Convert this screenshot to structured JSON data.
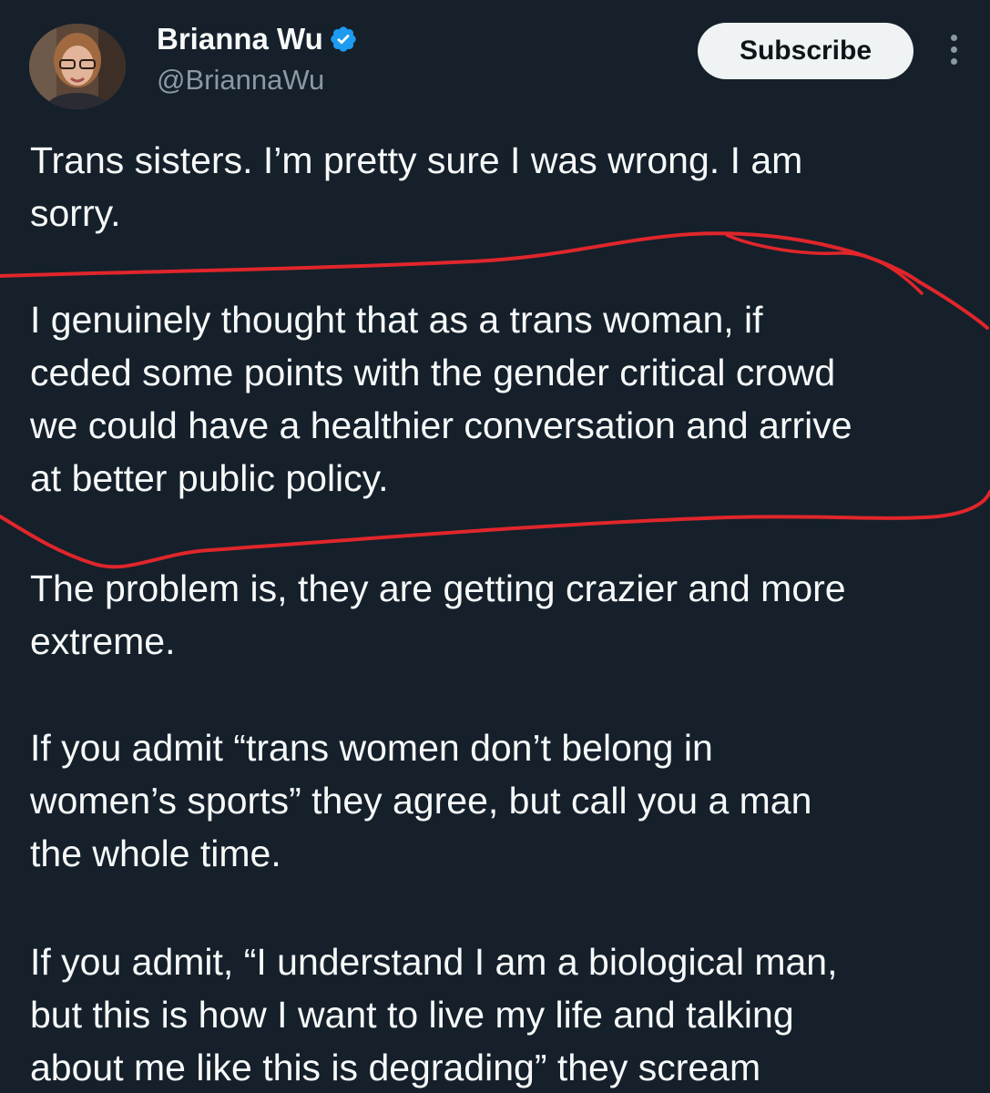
{
  "author": {
    "display_name": "Brianna Wu",
    "handle": "@BriannaWu",
    "verified_icon": "verified-badge-icon",
    "verified_color": "#1d9bf0"
  },
  "actions": {
    "subscribe_label": "Subscribe",
    "more_icon": "more-vertical-icon"
  },
  "tweet": {
    "paragraphs": [
      {
        "lines": [
          "Trans sisters. I’m pretty sure I was wrong. I am",
          "sorry."
        ]
      },
      {
        "lines": [
          "I genuinely thought that as a trans woman, if",
          "ceded some points with the gender critical crowd",
          "we could have a healthier conversation and arrive",
          "at better public policy."
        ]
      },
      {
        "lines": [
          "The problem is, they are getting crazier and more",
          "extreme."
        ]
      },
      {
        "lines": [
          "If you admit “trans women don’t belong in",
          "women’s sports” they agree, but call you a man",
          "the whole time."
        ]
      },
      {
        "lines": [
          "If you admit, “I understand I am a biological man,",
          "but this is how I want to live my life and talking",
          "about me like this is degrading” they scream"
        ]
      }
    ]
  },
  "colors": {
    "background": "#15202b",
    "text": "#f7f9f9",
    "secondary_text": "#8b98a5",
    "button_bg": "#eff3f4",
    "annotation": "#e0262b"
  }
}
